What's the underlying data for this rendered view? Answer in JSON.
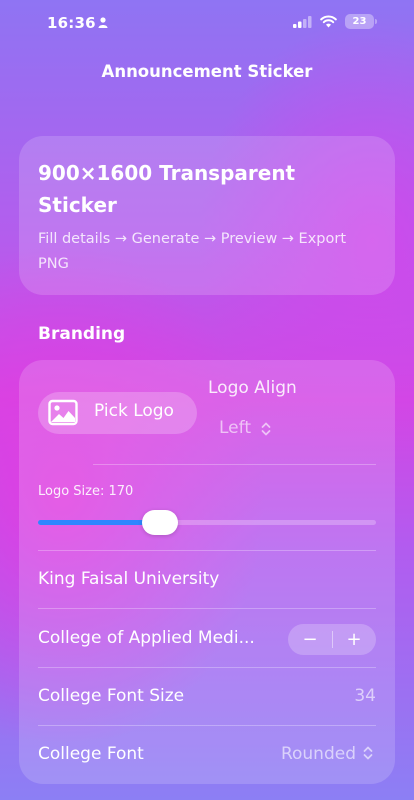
{
  "status_bar": {
    "time": "16:36",
    "battery": "23"
  },
  "nav": {
    "title": "Announcement Sticker"
  },
  "hero": {
    "title": "900×1600 Transparent Sticker",
    "subtitle": "Fill details → Generate → Preview → Export PNG"
  },
  "branding": {
    "section_title": "Branding",
    "pick_logo_label": "Pick Logo",
    "logo_align_label": "Logo Align",
    "logo_align_value": "Left",
    "logo_size_label": "Logo Size: 170",
    "logo_size_fraction": 0.36,
    "university_name": "King Faisal University",
    "college_name": "College of Applied Medi...",
    "stepper_minus": "−",
    "stepper_plus": "+",
    "college_font_size_label": "College Font Size",
    "college_font_size_value": "34",
    "college_font_label": "College Font",
    "college_font_value": "Rounded"
  },
  "colors": {
    "accent": "#2f86ff",
    "background_top": "#8f74f3",
    "background_mid": "#d346e4"
  }
}
